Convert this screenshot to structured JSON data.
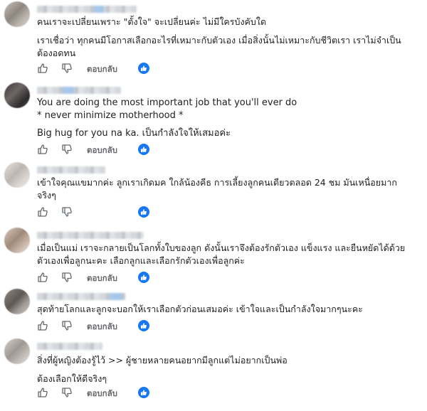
{
  "comments": [
    {
      "lines": [
        "คนเราจะเปลี่ยนเพราะ \"ตั้งใจ\" จะเปลี่ยนค่ะ ไม่มีใครบังคับใด",
        "เราเชื่อว่า ทุกคนมีโอกาสเลือกอะไรที่เหมาะกับตัวเอง เมื่อสิ่งนั้นไม่เหมาะกับชีวิตเรา เราไม่จำเป็น",
        "ต้องอดทน"
      ],
      "reply_label": "ตอบกลับ"
    },
    {
      "lines": [
        "You are doing the most important job that you'll ever do",
        "* never minimize motherhood *",
        "Big hug for you na ka. เป็นกำลังใจให้เสมอค่ะ"
      ],
      "reply_label": "ตอบกลับ"
    },
    {
      "lines": [
        "เข้าใจคุณแขมากค่ะ ลูกเราเกิดมค ใกล้น้องคีธ การเลี้ยงลูกคนเดียวตลอด 24 ชม มันเหนื่อยมาก",
        "จริงๆ"
      ],
      "reply_label": ""
    },
    {
      "lines": [
        "เมื่อเป็นแม่ เราจะกลายเป็นโลกทั้งใบของลูก ดังนั้นเราจึงต้องรักตัวเอง แข็งแรง และยืนหยัดได้ด้วย",
        "ตัวเองเพื่อลูกนะคะ เลือกลูกและเลือกรักตัวเองเพื่อลูกค่ะ"
      ],
      "reply_label": "ตอบกลับ"
    },
    {
      "lines": [
        "สุดท้ายโลกและลูกจะบอกให้เราเลือกตัวก่อนเสมอค่ะ เข้าใจและเป็นกำลังใจมากๆนะคะ"
      ],
      "reply_label": "ตอบกลับ"
    },
    {
      "lines": [
        "สิ่งที่ผู้หญิงต้องรู้ไว้ >> ผู้ชายหลายคนอยากมีลูกแต่ไม่อยากเป็นพ่อ",
        "ต้องเลือกให้ดีจริงๆ"
      ],
      "reply_label": "ตอบกลับ"
    }
  ],
  "icons": {
    "like": "thumbs-up-icon",
    "dislike": "thumbs-down-icon",
    "reaction": "like-reaction-badge-icon"
  },
  "colors": {
    "reaction_blue": "#1877f2",
    "meta_gray": "#65676b",
    "text": "#1c1e21"
  }
}
